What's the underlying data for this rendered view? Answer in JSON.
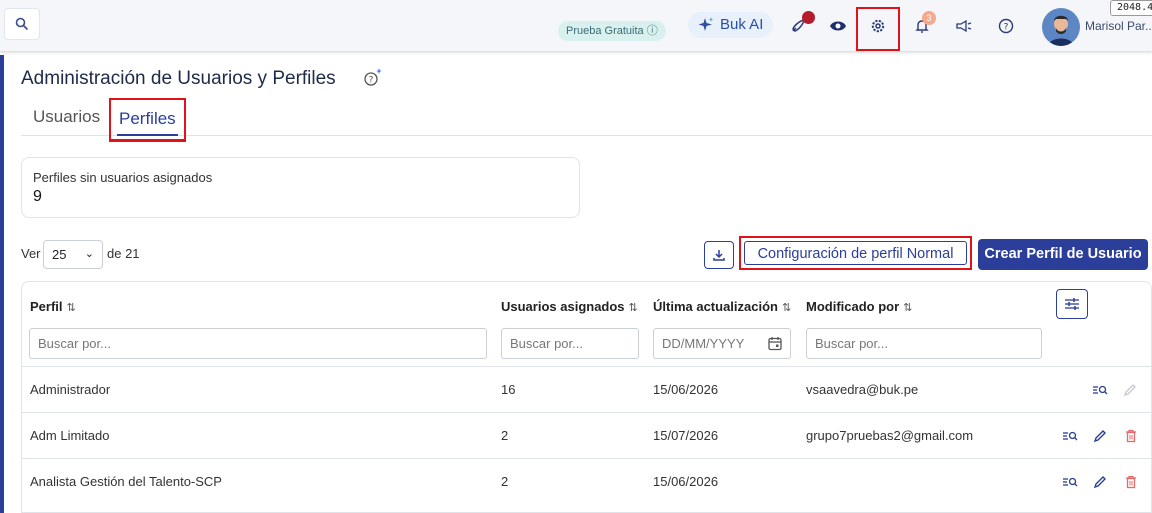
{
  "topbar": {
    "trial_label": "Prueba Gratuita ⓘ",
    "ai_label": "Buk AI",
    "notification_count": "3",
    "user_name": "Marisol Par...",
    "tooltip_text": "2048.4"
  },
  "page": {
    "title": "Administración de Usuarios y Perfiles"
  },
  "tabs": [
    {
      "label": "Usuarios",
      "active": false
    },
    {
      "label": "Perfiles",
      "active": true
    }
  ],
  "summary": {
    "label": "Perfiles sin usuarios asignados",
    "value": "9"
  },
  "pagination": {
    "prefix": "Ver",
    "page_size": "25",
    "suffix": "de 21"
  },
  "actions": {
    "config_label": "Configuración de perfil Normal",
    "create_label": "Crear Perfil de Usuario"
  },
  "table": {
    "columns": [
      {
        "label": "Perfil",
        "placeholder": "Buscar por..."
      },
      {
        "label": "Usuarios asignados",
        "placeholder": "Buscar por..."
      },
      {
        "label": "Última actualización",
        "placeholder": "DD/MM/YYYY"
      },
      {
        "label": "Modificado por",
        "placeholder": "Buscar por..."
      }
    ],
    "rows": [
      {
        "perfil": "Administrador",
        "usuarios": "16",
        "fecha": "15/06/2026",
        "modificado": "vsaavedra@buk.pe"
      },
      {
        "perfil": "Adm Limitado",
        "usuarios": "2",
        "fecha": "15/07/2026",
        "modificado": "grupo7pruebas2@gmail.com"
      },
      {
        "perfil": "Analista Gestión del Talento-SCP",
        "usuarios": "2",
        "fecha": "15/06/2026",
        "modificado": ""
      }
    ]
  },
  "colors": {
    "primary": "#2b3e9a",
    "highlight_red": "#e0121b",
    "delete_red": "#e56a6a"
  }
}
